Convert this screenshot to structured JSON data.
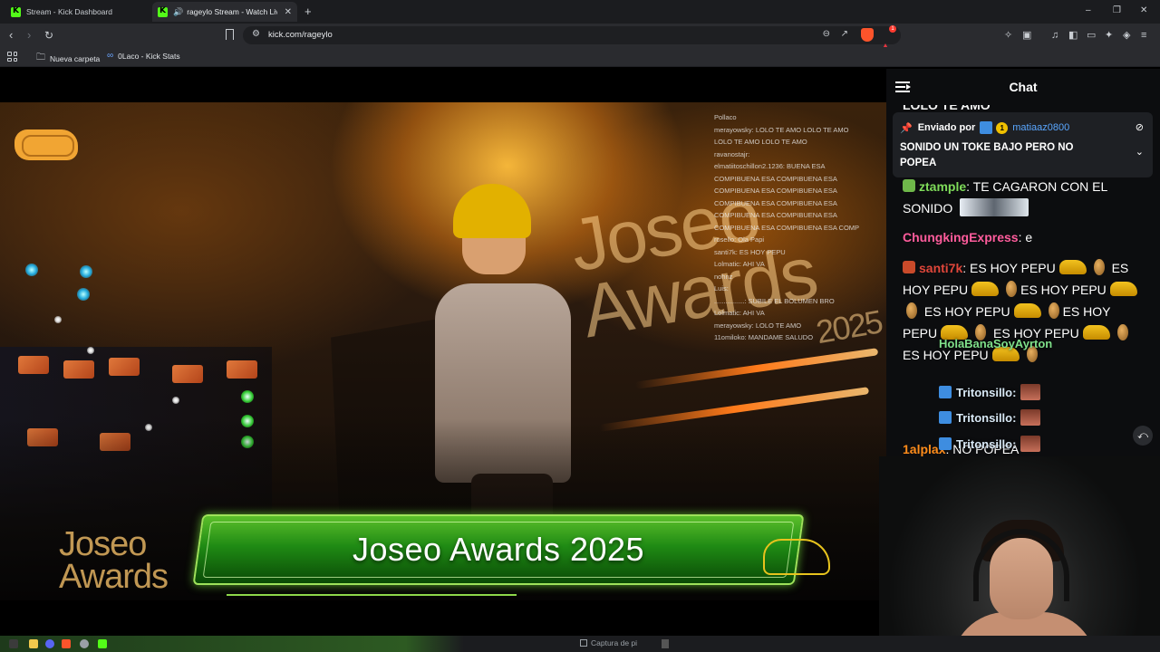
{
  "browser": {
    "tabs": [
      {
        "title": "Stream - Kick Dashboard",
        "active": false
      },
      {
        "title": "rageylo Stream - Watch Live o",
        "active": true,
        "audio": true
      }
    ],
    "new_tab_label": "+",
    "url": "kick.com/rageylo",
    "window_controls": {
      "minimize": "–",
      "restore": "❐",
      "close": "✕"
    }
  },
  "bookmarks": [
    {
      "label": "Nueva carpeta",
      "icon": "folder-icon"
    },
    {
      "label": "0Laco - Kick Stats",
      "icon": "link-icon"
    }
  ],
  "video": {
    "banner_title": "Joseo Awards 2025",
    "stage_title_line1": "Joseo",
    "stage_title_line2": "Awards",
    "stage_year": "2025",
    "corner_title_line1": "Joseo",
    "corner_title_line2": "Awards",
    "corner_year": "2025",
    "overlay_chat": [
      "Pollaco",
      "merayowsky: LOLO TE AMO LOLO TE AMO",
      "LOLO TE AMO LOLO TE AMO",
      "ravanostajr:",
      "elmatiitoschillon2.1236: BUENA ESA",
      "COMPIBUENA ESA COMPIBUENA ESA",
      "COMPIBUENA ESA COMPIBUENA ESA",
      "COMPIBUENA ESA COMPIBUENA ESA",
      "COMPIBUENA ESA COMPIBUENA ESA",
      "COMPIBUENA ESA COMPIBUENA ESA COMP",
      "rosello: Ola Papi",
      "santi7k: ES HOY PEPU",
      "Lolmatic: AHI VA",
      "nohnz",
      "Luis:",
      "................: SUBILE EL BOLUMEN BRO",
      "Lolmatic: AHI VA",
      "merayowsky: LOLO TE AMO",
      "11omiloko: MANDAME SALUDO"
    ]
  },
  "chat": {
    "title": "Chat",
    "cut_message": "LOLO TE AMO",
    "pinned": {
      "prefix": "Enviado por",
      "badge_count": "1",
      "user": "matiaaz0800",
      "text": "SONIDO UN TOKE BAJO PERO NO POPEA"
    },
    "messages": [
      {
        "user": "ztample",
        "text": ": TE CAGARON CON EL SONIDO"
      },
      {
        "user": "ChungkingExpress",
        "text": ": e"
      },
      {
        "user": "santi7k",
        "text": ": ES HOY PEPU"
      },
      {
        "user": "1alplax",
        "text": ": NO POPEA"
      }
    ],
    "spam_line": "ES HOY PEPU",
    "overlay_names": [
      "HolaBanaSoyAyrton",
      "Tritonsillo",
      "Tritonsillo",
      "Tritonsillo"
    ],
    "overlay_sep": ":"
  },
  "taskbar": {
    "snip_label": "Captura de pi"
  },
  "colors": {
    "kick_green": "#53fc18",
    "chat_bg": "#0c0d0f",
    "pinned_bg": "#1e2024",
    "link_blue": "#5aa7ff"
  }
}
